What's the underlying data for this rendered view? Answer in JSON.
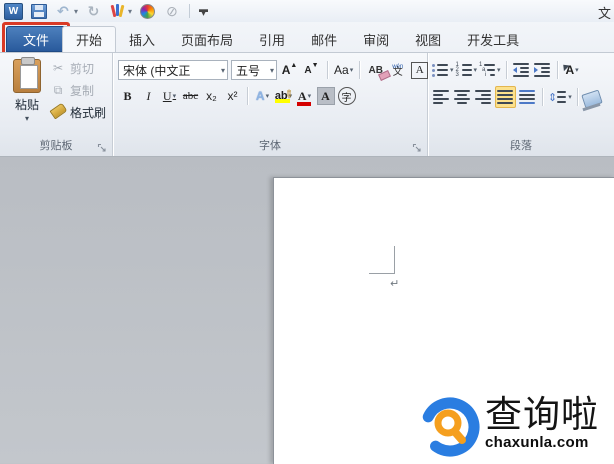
{
  "titlebar": {
    "partial_title": "文",
    "app_initial": "W"
  },
  "tabs": {
    "file": "文件",
    "active": "开始",
    "items": [
      "开始",
      "插入",
      "页面布局",
      "引用",
      "邮件",
      "审阅",
      "视图",
      "开发工具"
    ]
  },
  "ribbon": {
    "clipboard": {
      "label": "剪贴板",
      "paste": "粘贴",
      "paste_drop": "▾",
      "cut": "剪切",
      "copy": "复制",
      "format_painter": "格式刷",
      "cut_icon": "✂"
    },
    "font": {
      "label": "字体",
      "font_name_value": "宋体 (中文正",
      "font_size_value": "五号",
      "grow": "A",
      "shrink": "A",
      "grow_mark": "▲",
      "shrink_mark": "▼",
      "change_case": "Aa",
      "clear_format": "AB",
      "phonetic_top": "wén",
      "phonetic_bottom": "文",
      "char_border": "A",
      "bold": "B",
      "italic": "I",
      "underline": "U",
      "strikethrough": "abc",
      "subscript": "x₂",
      "superscript": "x²",
      "text_effects": "A",
      "highlight": "ab",
      "font_color": "A",
      "char_shading": "A",
      "enclose_char": "字",
      "dropdown": "▾"
    },
    "paragraph": {
      "label": "段落",
      "sort": "A",
      "dropdown": "▾",
      "line_spacing_arrows": "⇕"
    }
  },
  "document": {
    "paragraph_mark": "↵"
  },
  "watermark": {
    "name": "查询啦",
    "domain": "chaxunla.com"
  },
  "colors": {
    "file_tab_blue": "#2e5e9e",
    "annotation_red": "#d93a26",
    "selected_button_yellow": "#fce18c",
    "highlight_yellow": "#ffff00",
    "font_color_red": "#d40000",
    "logo_blue": "#2a7de1",
    "logo_orange": "#f59f1e",
    "document_gray": "#c1c5ca"
  }
}
